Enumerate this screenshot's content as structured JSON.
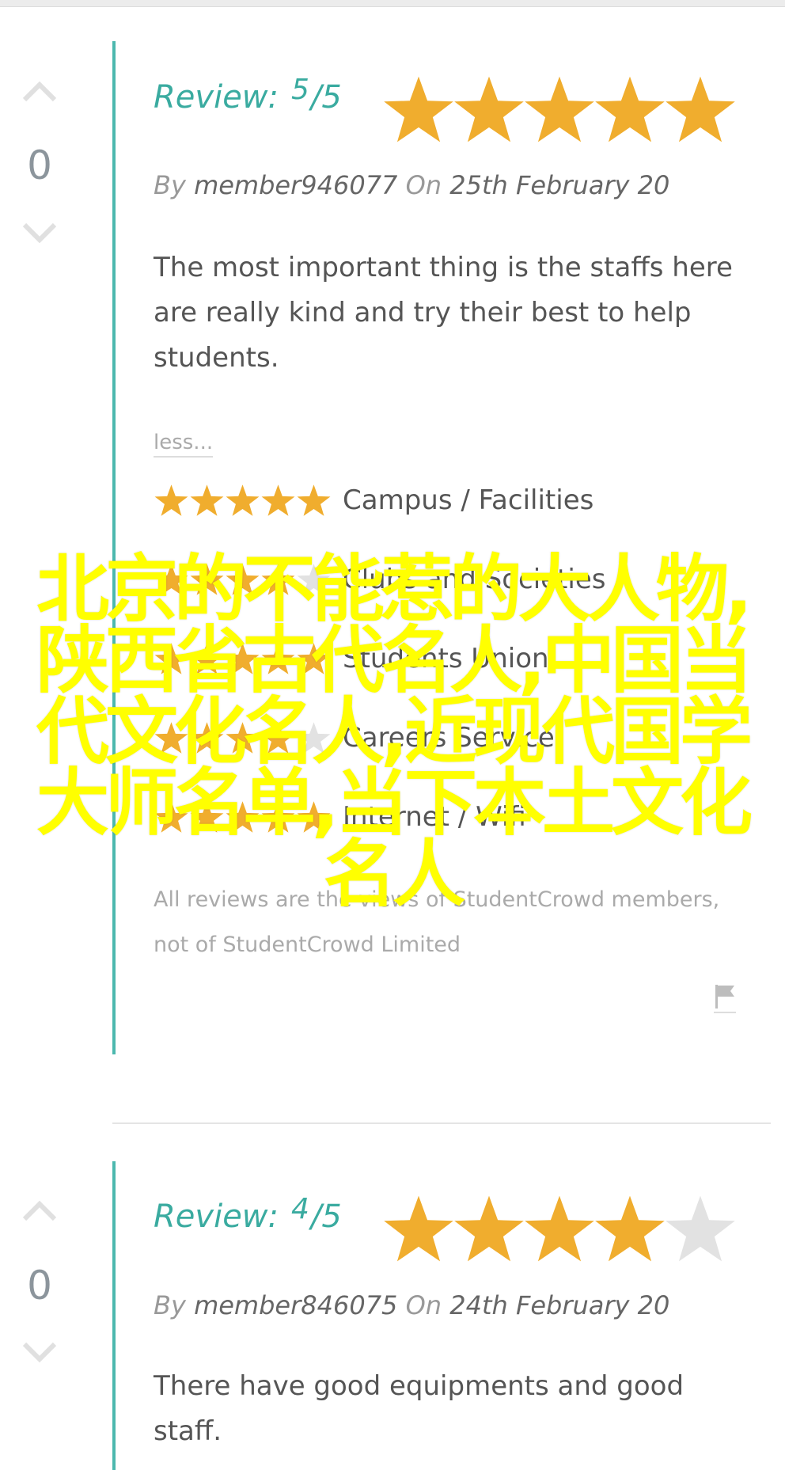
{
  "reviews": [
    {
      "votes": "0",
      "review_label": "Review:",
      "rating": "5",
      "rating_max": "/5",
      "rating_value": 5,
      "by_label": "By",
      "author": "member946077",
      "on_label": "On",
      "date": "25th February 20",
      "body": "The most important thing is the staffs here are really kind and try their best to help students.",
      "less_link": "less...",
      "categories": [
        {
          "label": "Campus / Facilities",
          "stars": 5
        },
        {
          "label": "Clubs and Societies",
          "stars": 4
        },
        {
          "label": "Students Union",
          "stars": 5
        },
        {
          "label": "Careers Service",
          "stars": 4
        },
        {
          "label": "Internet / Wifi",
          "stars": 5
        }
      ],
      "disclaimer": "All reviews are the views of StudentCrowd members, not of StudentCrowd Limited"
    },
    {
      "votes": "0",
      "review_label": "Review:",
      "rating": "4",
      "rating_max": "/5",
      "rating_value": 4,
      "by_label": "By",
      "author": "member846075",
      "on_label": "On",
      "date": "24th February 20",
      "body": "There have good equipments and good staff."
    }
  ],
  "overlay_text": "北京的不能惹的大人物,陕西省古代名人,中国当代文化名人,近现代国学大师名单,当下本土文化名人",
  "colors": {
    "accent": "#4cb8ae",
    "star_on": "#f0ad2e",
    "star_off": "#e2e2e2",
    "overlay": "#ffff00"
  },
  "icons": [
    "vote-up-icon",
    "vote-down-icon",
    "star-icon",
    "flag-icon"
  ]
}
